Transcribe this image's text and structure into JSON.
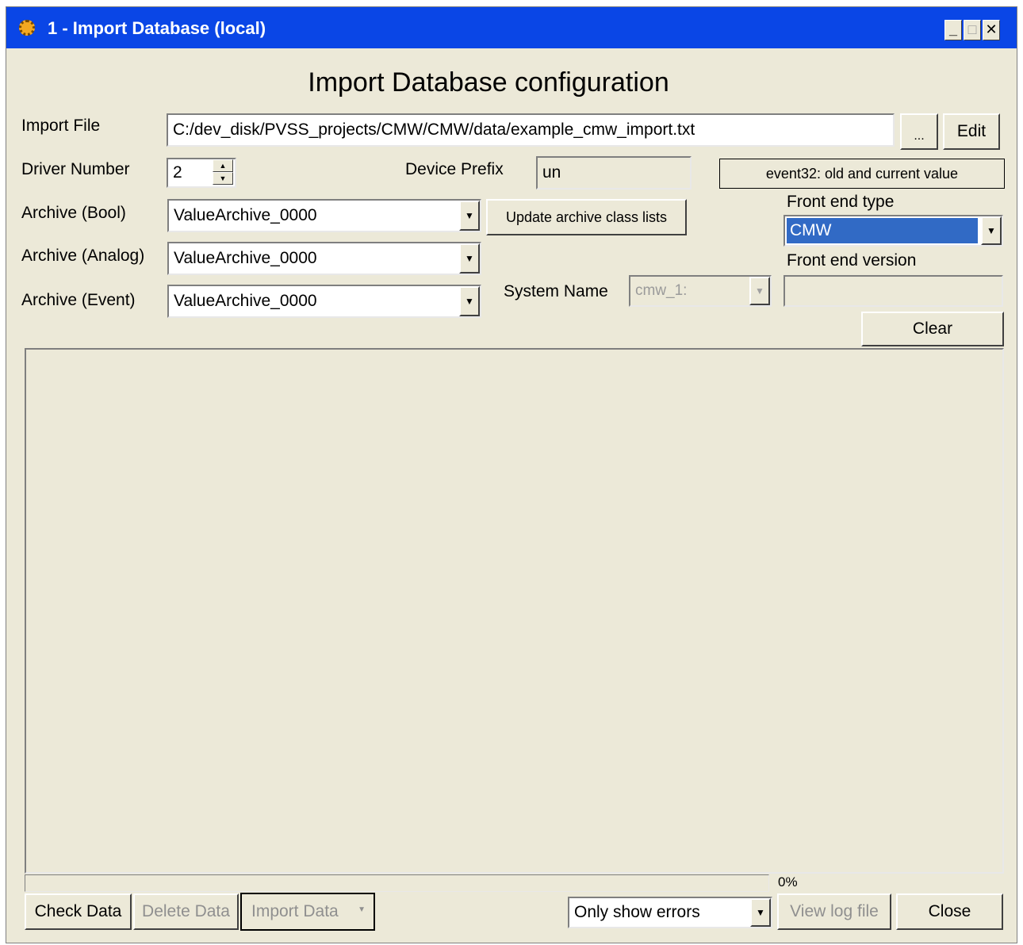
{
  "window": {
    "title": "1 - Import Database (local)",
    "minimize_glyph": "_",
    "maximize_glyph": "□",
    "close_glyph": "✕"
  },
  "heading": "Import Database configuration",
  "import_file": {
    "label": "Import File",
    "value": "C:/dev_disk/PVSS_projects/CMW/CMW/data/example_cmw_import.txt",
    "browse_label": "...",
    "edit_label": "Edit"
  },
  "driver": {
    "label": "Driver Number",
    "value": "2"
  },
  "device_prefix": {
    "label": "Device Prefix",
    "value": "un"
  },
  "event_mode": "event32: old and current value",
  "archives": {
    "bool_label": "Archive (Bool)",
    "bool_value": "ValueArchive_0000",
    "analog_label": "Archive (Analog)",
    "analog_value": "ValueArchive_0000",
    "event_label": "Archive (Event)",
    "event_value": "ValueArchive_0000",
    "update_label": "Update archive class lists"
  },
  "front_end": {
    "type_label": "Front end type",
    "type_value": "CMW",
    "version_label": "Front end version",
    "version_value": "",
    "clear_label": "Clear"
  },
  "system_name": {
    "label": "System Name",
    "value": "cmw_1:"
  },
  "progress": {
    "percent_text": "0%",
    "value": 0
  },
  "footer": {
    "check_label": "Check Data",
    "delete_label": "Delete Data",
    "import_label": "Import Data",
    "filter_value": "Only show errors",
    "view_log_label": "View log file",
    "close_label": "Close"
  },
  "colors": {
    "titlebar": "#0a46e6",
    "window_bg": "#ece9d8",
    "selection": "#316ac5"
  }
}
